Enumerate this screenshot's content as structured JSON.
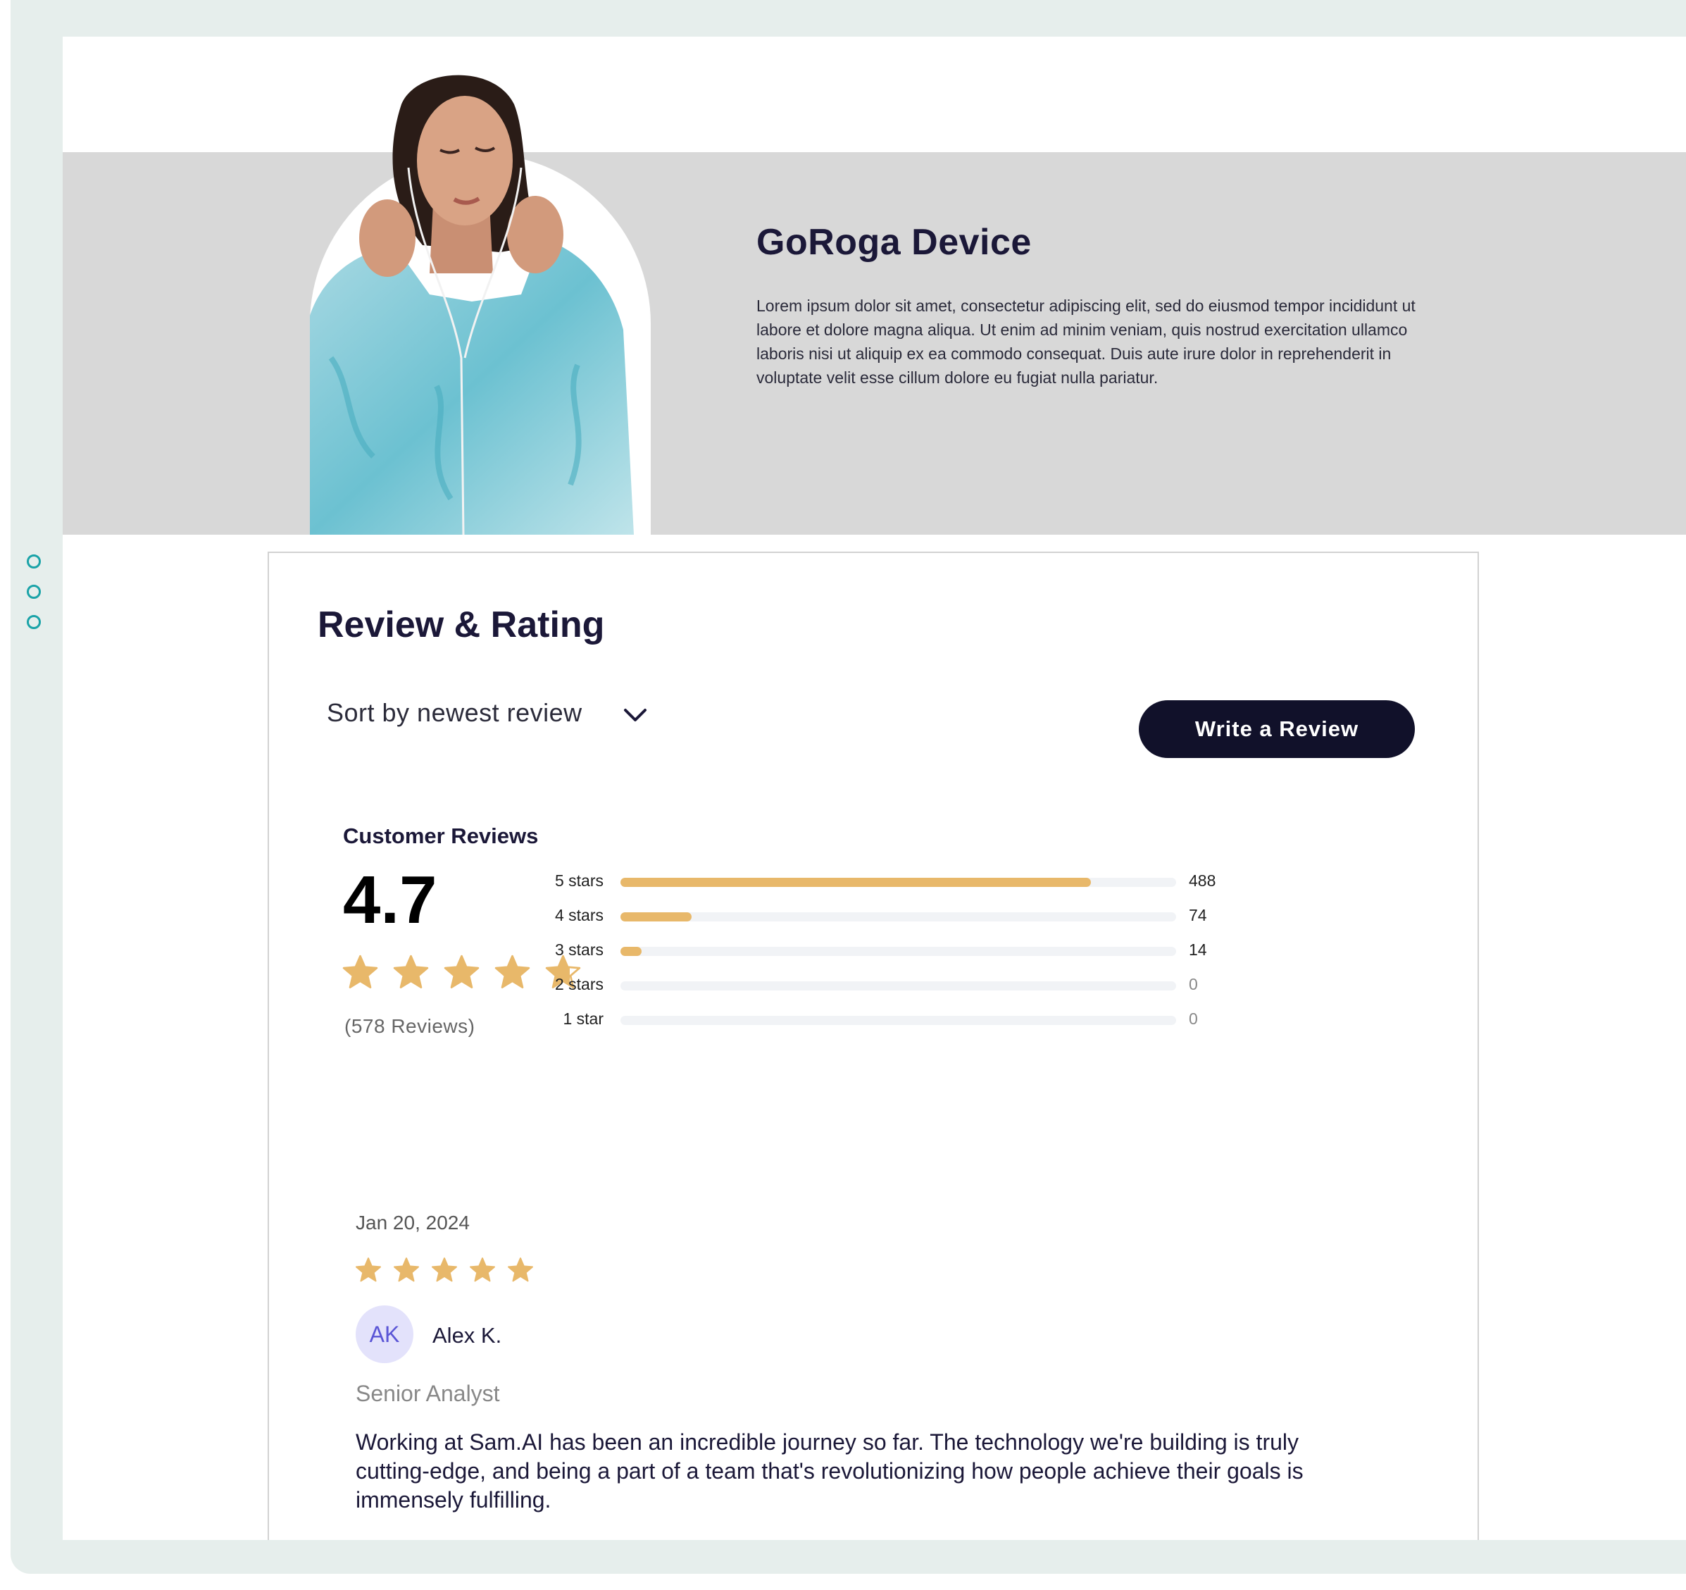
{
  "product": {
    "title": "GoRoga Device",
    "description": "Lorem ipsum dolor sit amet, consectetur adipiscing elit, sed do eiusmod tempor incididunt ut labore et dolore magna aliqua. Ut enim ad minim veniam, quis nostrud exercitation ullamco laboris nisi ut aliquip ex ea commodo consequat. Duis aute irure dolor in reprehenderit in voluptate velit esse cillum dolore eu fugiat nulla pariatur."
  },
  "reviews_section": {
    "title": "Review & Rating",
    "sort_label": "Sort by newest review",
    "write_button": "Write a Review"
  },
  "summary": {
    "heading": "Customer Reviews",
    "average": "4.7",
    "average_rating": 4.7,
    "review_count": "(578 Reviews)",
    "bars": [
      {
        "label": "5 stars",
        "count": "488",
        "value": 488
      },
      {
        "label": "4 stars",
        "count": "74",
        "value": 74
      },
      {
        "label": "3 stars",
        "count": "14",
        "value": 14
      },
      {
        "label": "2 stars",
        "count": "0",
        "value": 0
      },
      {
        "label": "1 star",
        "count": "0",
        "value": 0
      }
    ]
  },
  "review": {
    "date": "Jan 20, 2024",
    "rating": 5,
    "initials": "AK",
    "name": "Alex K.",
    "role": "Senior Analyst",
    "text": "Working at Sam.AI has been an incredible journey so far. The technology we're building is truly cutting-edge, and being a part of a team that's revolutionizing how people achieve their goals is immensely fulfilling."
  },
  "colors": {
    "star": "#e8b86a",
    "bar_fill": "#e8b86a",
    "bar_track": "#f1f3f6",
    "button_bg": "#11112a",
    "accent_dots": "#1aa3a8",
    "avatar_bg": "#e3e2fb",
    "avatar_text": "#5a55d6"
  }
}
